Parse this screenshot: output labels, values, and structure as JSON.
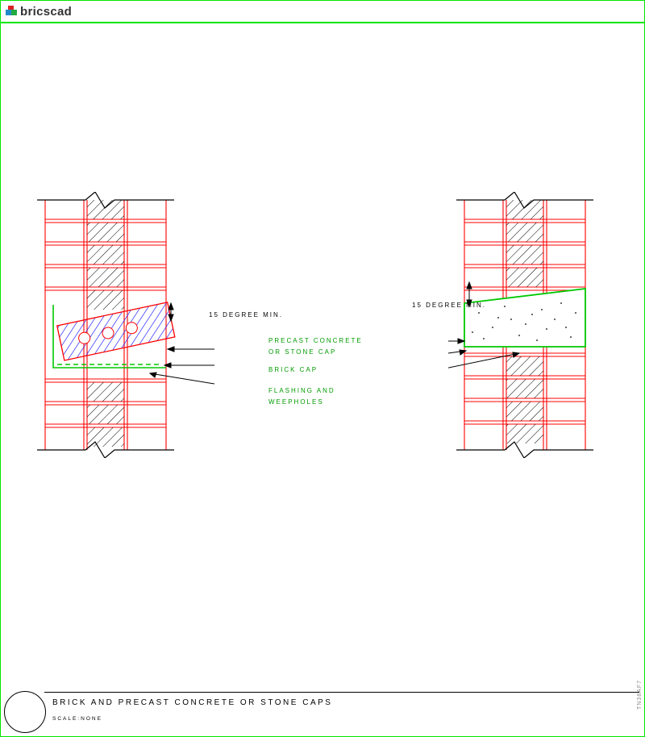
{
  "app": {
    "name": "bricscad"
  },
  "labels": {
    "deg_left": "15 DEGREE MIN.",
    "deg_right": "15 DEGREE MIN.",
    "precast1": "PRECAST CONCRETE",
    "precast2": "OR STONE CAP",
    "brickcap": "BRICK CAP",
    "flash1": "FLASHING AND",
    "flash2": "WEEPHOLES"
  },
  "title": {
    "main": "BRICK AND PRECAST CONCRETE OR STONE CAPS",
    "scale": "SCALE:NONE"
  },
  "stamp": "TN38AF7",
  "chart_data": {
    "type": "diagram",
    "title": "BRICK AND PRECAST CONCRETE OR STONE CAPS",
    "scale": "NONE",
    "left_detail": {
      "description": "Brick wall section with brick cap (holes) at 15° min slope",
      "callouts": [
        "15 DEGREE MIN.",
        "PRECAST CONCRETE OR STONE CAP",
        "BRICK CAP",
        "FLASHING AND WEEPHOLES"
      ]
    },
    "right_detail": {
      "description": "Brick wall with precast concrete / stone cap at 15° min slope",
      "callouts": [
        "15 DEGREE MIN."
      ]
    }
  }
}
